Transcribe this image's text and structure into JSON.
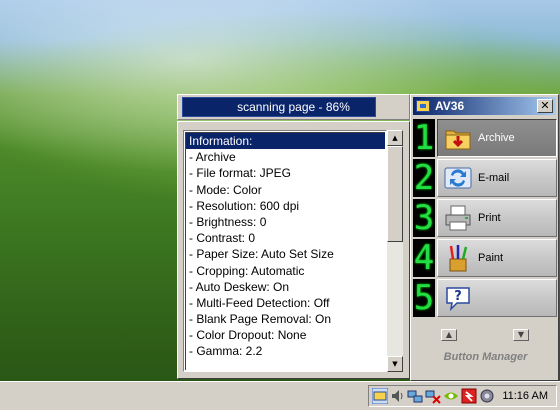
{
  "progress": {
    "text": "scanning page - 86%",
    "percent": 86
  },
  "info_list": {
    "items": [
      "Information:",
      "- Archive",
      "- File format: JPEG",
      "- Mode: Color",
      "- Resolution: 600 dpi",
      "- Brightness: 0",
      "- Contrast: 0",
      "- Paper Size: Auto Set Size",
      "- Cropping: Automatic",
      "- Auto Deskew: On",
      "- Multi-Feed Detection: Off",
      "- Blank Page Removal: On",
      "- Color Dropout: None",
      "- Gamma: 2.2"
    ],
    "selected_index": 0
  },
  "button_manager": {
    "title": "AV36",
    "close_label": "✕",
    "footer": "Button Manager",
    "buttons": [
      {
        "digit": "1",
        "label": "Archive",
        "icon": "archive-folder-icon",
        "active": true
      },
      {
        "digit": "2",
        "label": "E-mail",
        "icon": "email-arrows-icon",
        "active": false
      },
      {
        "digit": "3",
        "label": "Print",
        "icon": "printer-icon",
        "active": false
      },
      {
        "digit": "4",
        "label": "Paint",
        "icon": "paint-brushes-icon",
        "active": false
      },
      {
        "digit": "5",
        "label": "",
        "icon": "help-question-icon",
        "active": false
      }
    ]
  },
  "taskbar": {
    "clock": "11:16 AM",
    "tray_icons": [
      "button-manager-icon",
      "volume-icon",
      "network-icon",
      "network-disconnected-icon",
      "nvidia-icon",
      "antivirus-icon",
      "settings-icon"
    ]
  },
  "colors": {
    "selection": "#0a246a",
    "digit": "#22dd44",
    "face": "#d4d0c8"
  }
}
